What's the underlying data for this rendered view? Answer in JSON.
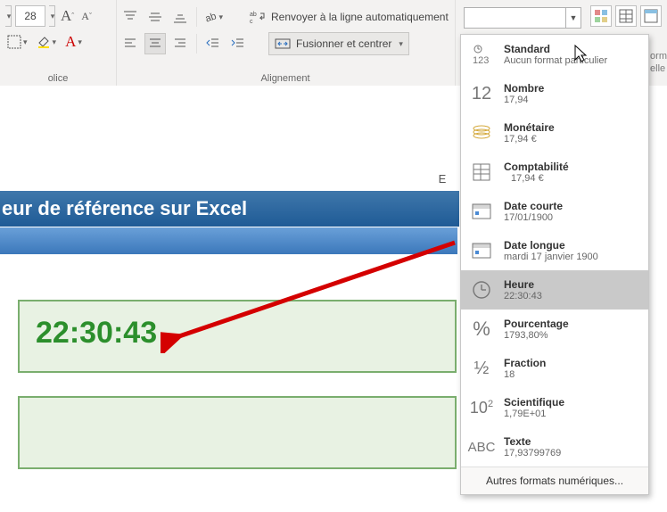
{
  "ribbon": {
    "font": {
      "size": "28",
      "group_label": "olice"
    },
    "alignment": {
      "wrap_label": "Renvoyer à la ligne automatiquement",
      "merge_label": "Fusionner et centrer",
      "group_label": "Alignement"
    },
    "number": {
      "stray_line1": "orm",
      "stray_line2": "elle"
    }
  },
  "sheet": {
    "col_e": "E",
    "title": "eur de référence sur Excel",
    "big_time": "22:30:43"
  },
  "dropdown": {
    "items": [
      {
        "title": "Standard",
        "sub": "Aucun format particulier"
      },
      {
        "title": "Nombre",
        "sub": "17,94"
      },
      {
        "title": "Monétaire",
        "sub": "17,94 €"
      },
      {
        "title": "Comptabilité",
        "sub": "17,94 €"
      },
      {
        "title": "Date courte",
        "sub": "17/01/1900"
      },
      {
        "title": "Date longue",
        "sub": "mardi 17 janvier 1900"
      },
      {
        "title": "Heure",
        "sub": "22:30:43"
      },
      {
        "title": "Pourcentage",
        "sub": "1793,80%"
      },
      {
        "title": "Fraction",
        "sub": "18"
      },
      {
        "title": "Scientifique",
        "sub": "1,79E+01"
      },
      {
        "title": "Texte",
        "sub": "17,93799769"
      }
    ],
    "footer": "Autres formats numériques..."
  }
}
